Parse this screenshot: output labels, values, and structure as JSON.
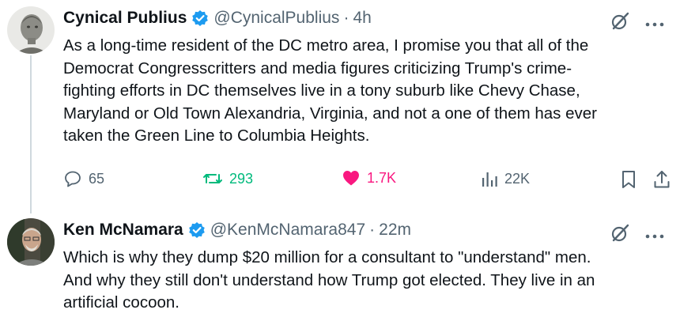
{
  "tweets": [
    {
      "author": "Cynical Publius",
      "handle": "@CynicalPublius",
      "time": "4h",
      "text": "As a long-time resident of the DC metro area, I promise you that all of the\nDemocrat Congresscritters and media figures criticizing Trump's crime-\nfighting efforts in DC themselves live in a tony suburb like Chevy Chase,\nMaryland or Old Town Alexandria, Virginia, and not a one of them has ever\ntaken the Green Line to Columbia Heights.",
      "metrics": {
        "replies": "65",
        "reposts": "293",
        "likes": "1.7K",
        "views": "22K"
      },
      "icons": [
        "verified-icon",
        "grok-icon",
        "more-icon",
        "reply-icon",
        "repost-icon",
        "like-icon",
        "views-icon",
        "bookmark-icon",
        "share-icon"
      ]
    },
    {
      "author": "Ken McNamara",
      "handle": "@KenMcNamara847",
      "time": "22m",
      "text": "Which is why they dump $20 million for a consultant to \"understand\" men.\nAnd why they still don't understand how Trump got elected.  They live in an\nartificial cocoon.",
      "icons": [
        "verified-icon",
        "grok-icon",
        "more-icon"
      ]
    }
  ],
  "separator": "·",
  "colors": {
    "verified": "#1d9bf0",
    "repost": "#00ba7c",
    "like": "#f91880",
    "secondary_text": "#536471"
  }
}
